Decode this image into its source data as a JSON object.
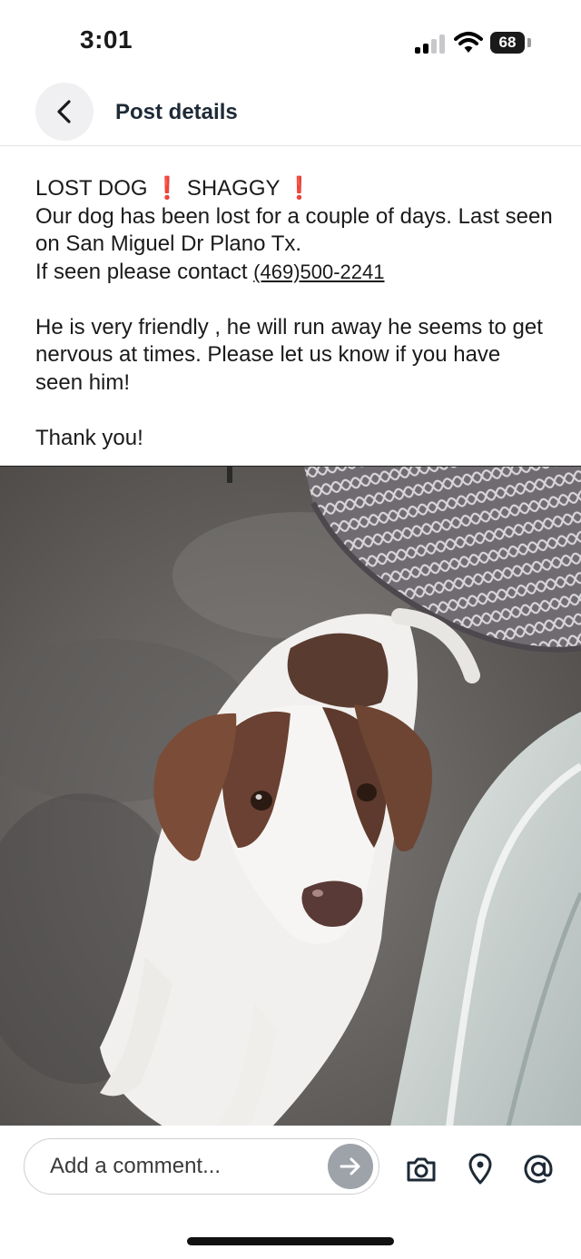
{
  "status_bar": {
    "time": "3:01",
    "battery": "68"
  },
  "header": {
    "title": "Post details"
  },
  "post": {
    "title_left": "LOST DOG",
    "title_right": "SHAGGY",
    "alert_mark": "❗",
    "line1": "Our dog has been lost for a couple of days. Last seen on San Miguel Dr Plano Tx.",
    "contact_prefix": "If seen please contact ",
    "phone": "(469)500-2241",
    "paragraph2": "He is very friendly , he will run away he seems to get nervous at times. Please let us know if you have seen him!",
    "closing": "Thank you!"
  },
  "comment": {
    "placeholder": "Add a comment..."
  },
  "icons": {
    "back": "chevron-left-icon",
    "send": "arrow-right-icon",
    "camera": "camera-icon",
    "location": "location-pin-icon",
    "mention": "at-sign-icon"
  },
  "colors": {
    "alert": "#e0201c",
    "send_button": "#9ea3aa",
    "title": "#1e2a36"
  }
}
